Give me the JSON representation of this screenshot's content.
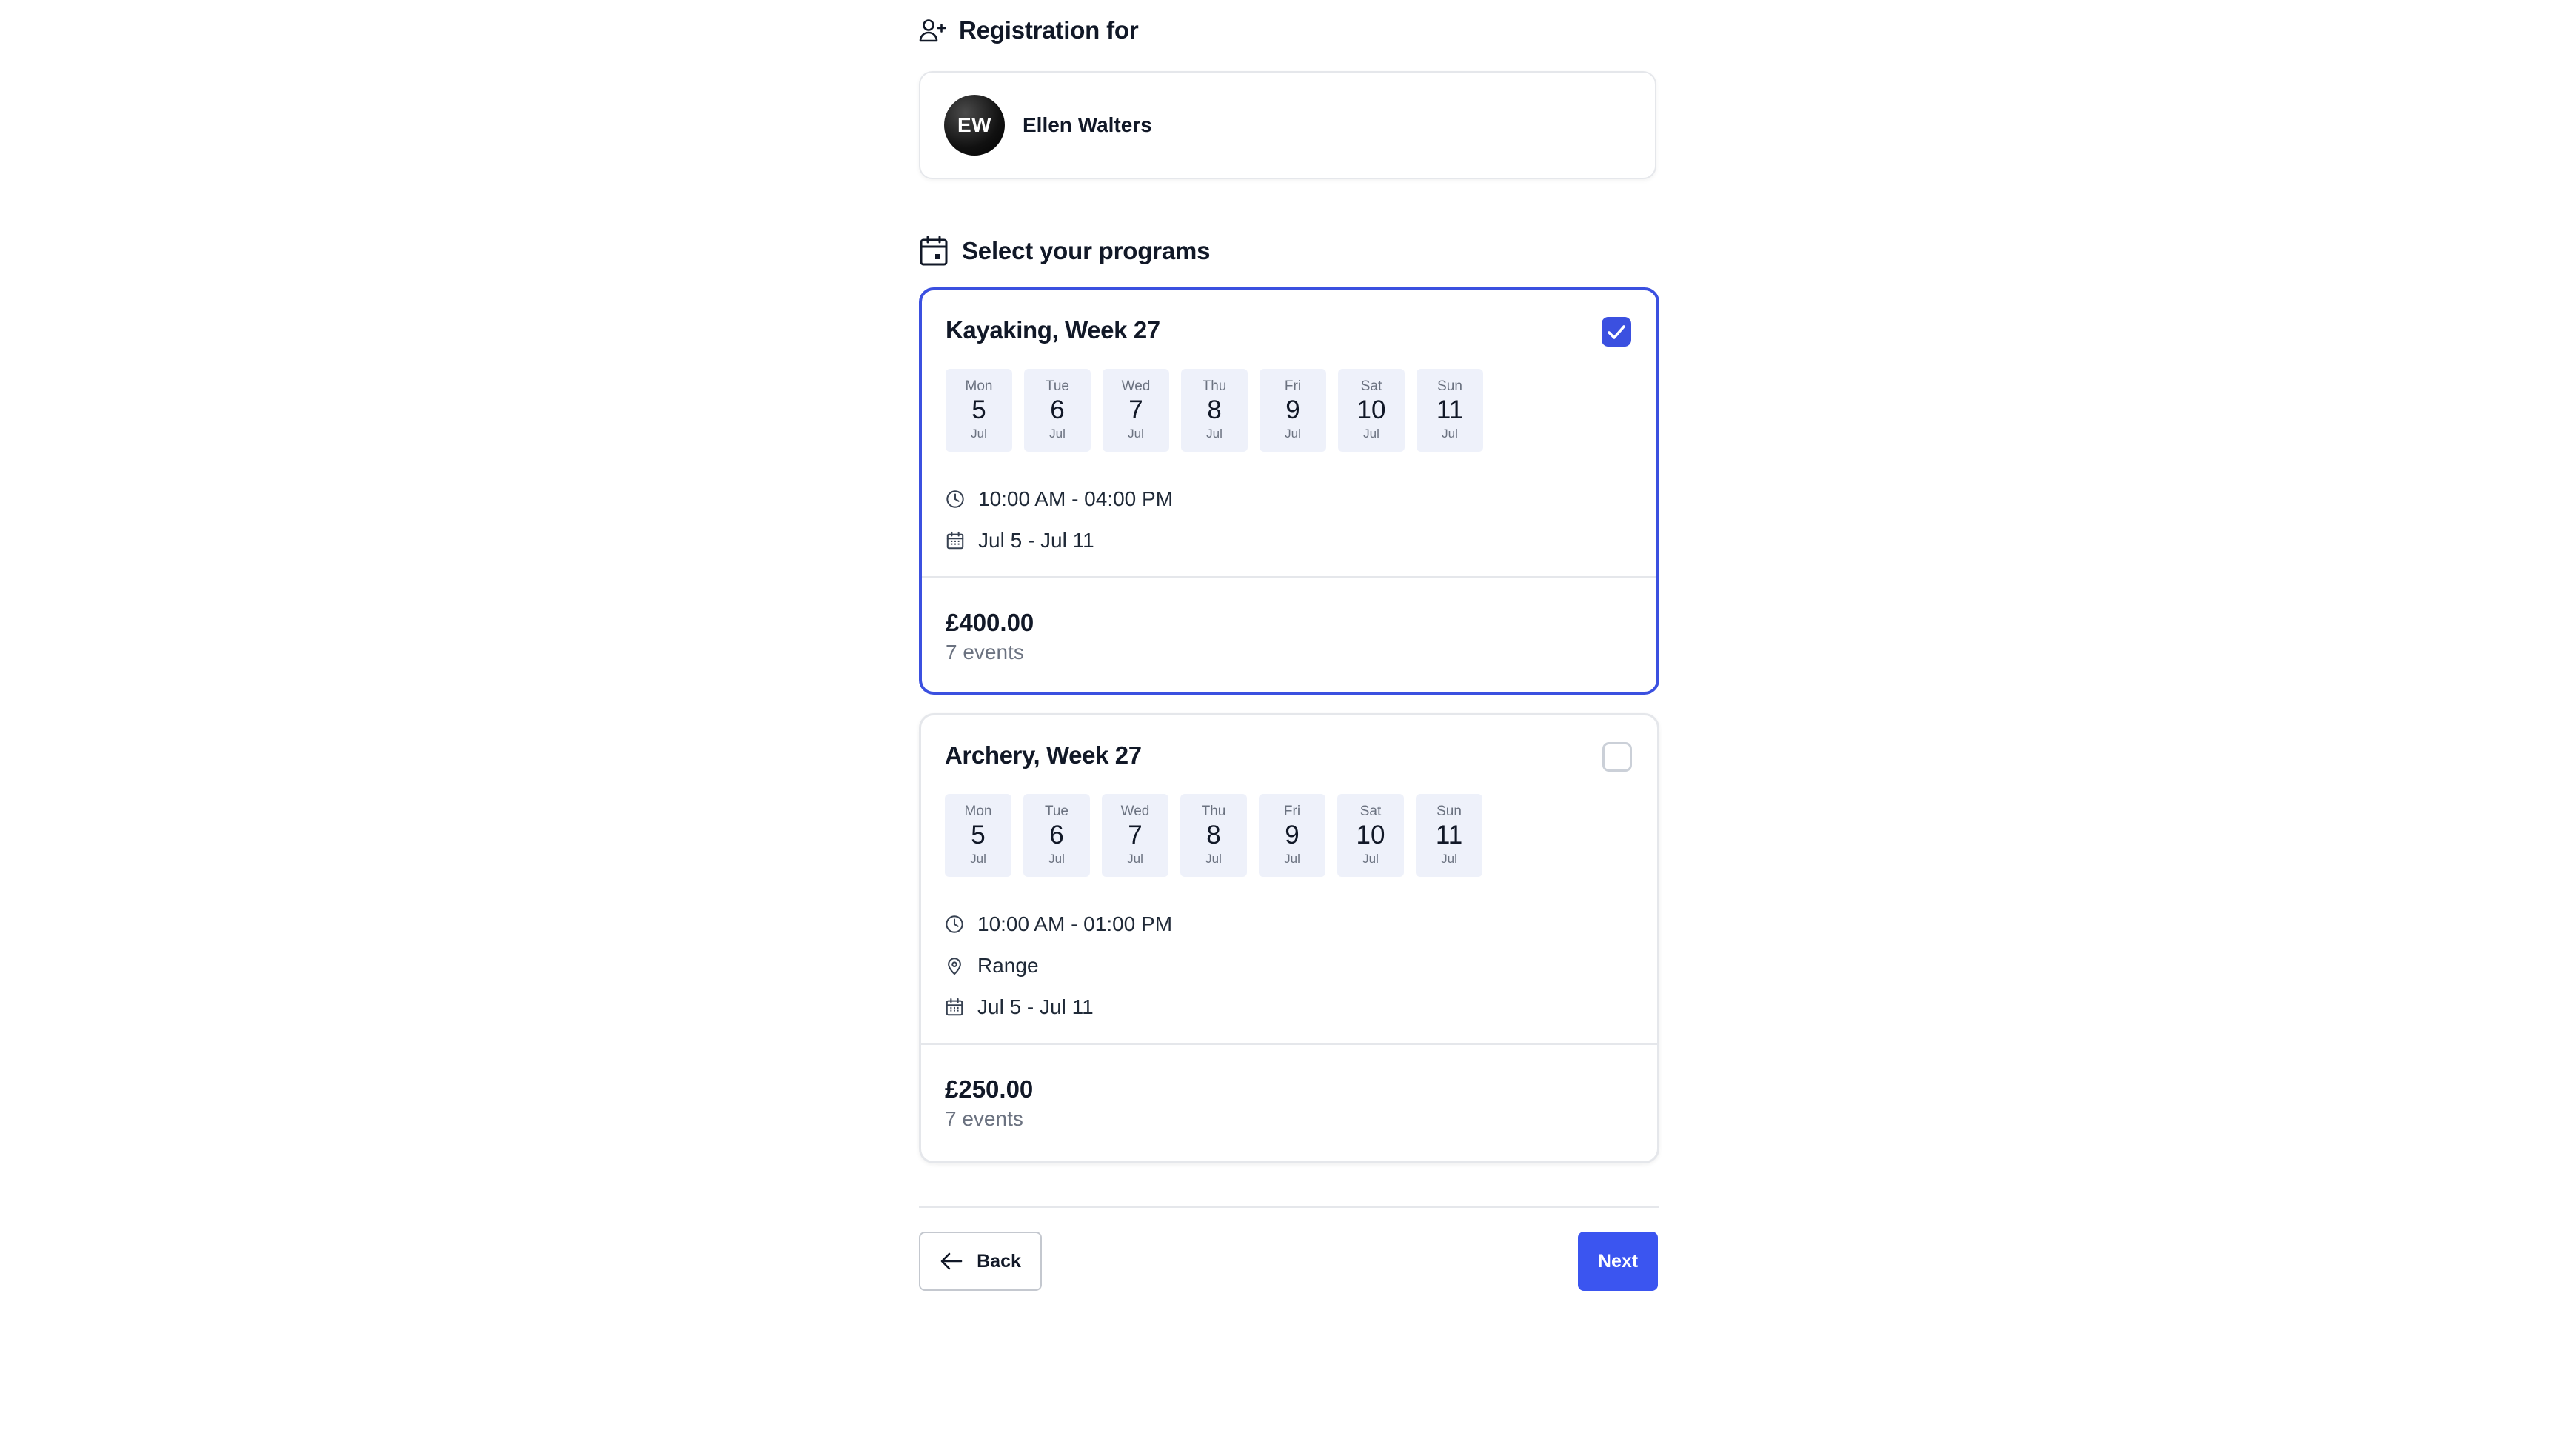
{
  "registration": {
    "title": "Registration for",
    "icon": "user-add-icon"
  },
  "user": {
    "initials": "EW",
    "name": "Ellen Walters"
  },
  "programs_section": {
    "title": "Select your programs",
    "icon": "calendar-icon"
  },
  "programs": [
    {
      "title": "Kayaking, Week 27",
      "selected": true,
      "days": [
        {
          "dow": "Mon",
          "num": "5",
          "month": "Jul"
        },
        {
          "dow": "Tue",
          "num": "6",
          "month": "Jul"
        },
        {
          "dow": "Wed",
          "num": "7",
          "month": "Jul"
        },
        {
          "dow": "Thu",
          "num": "8",
          "month": "Jul"
        },
        {
          "dow": "Fri",
          "num": "9",
          "month": "Jul"
        },
        {
          "dow": "Sat",
          "num": "10",
          "month": "Jul"
        },
        {
          "dow": "Sun",
          "num": "11",
          "month": "Jul"
        }
      ],
      "time": "10:00 AM - 04:00 PM",
      "dates": "Jul 5 - Jul 11",
      "price": "£400.00",
      "events": "7 events"
    },
    {
      "title": "Archery, Week 27",
      "selected": false,
      "days": [
        {
          "dow": "Mon",
          "num": "5",
          "month": "Jul"
        },
        {
          "dow": "Tue",
          "num": "6",
          "month": "Jul"
        },
        {
          "dow": "Wed",
          "num": "7",
          "month": "Jul"
        },
        {
          "dow": "Thu",
          "num": "8",
          "month": "Jul"
        },
        {
          "dow": "Fri",
          "num": "9",
          "month": "Jul"
        },
        {
          "dow": "Sat",
          "num": "10",
          "month": "Jul"
        },
        {
          "dow": "Sun",
          "num": "11",
          "month": "Jul"
        }
      ],
      "time": "10:00 AM - 01:00 PM",
      "location": "Range",
      "dates": "Jul 5 - Jul 11",
      "price": "£250.00",
      "events": "7 events"
    }
  ],
  "footer": {
    "back_label": "Back",
    "next_label": "Next"
  },
  "colors": {
    "accent": "#3b50e0",
    "next_button": "#3b55f0",
    "day_chip_bg": "#eef1fa"
  }
}
